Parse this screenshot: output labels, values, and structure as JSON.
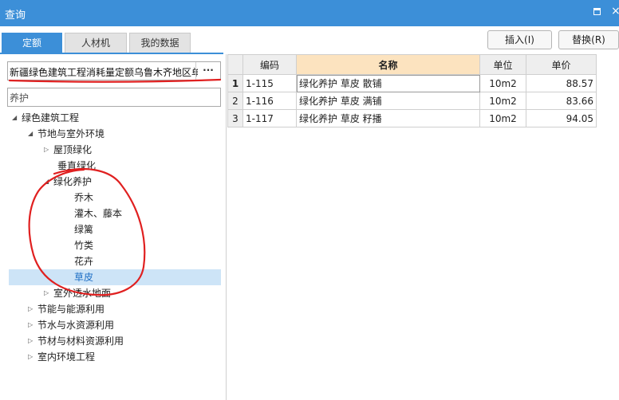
{
  "window": {
    "title": "查询",
    "restore_icon": "restore-icon",
    "close_glyph": "×"
  },
  "tabs": [
    {
      "label": "定额",
      "active": true
    },
    {
      "label": "人材机",
      "active": false
    },
    {
      "label": "我的数据",
      "active": false
    }
  ],
  "toolbar": {
    "insert_label": "插入(I)",
    "replace_label": "替换(R)"
  },
  "library": {
    "selected": "新疆绿色建筑工程消耗量定额乌鲁木齐地区单",
    "more_label": "···"
  },
  "search": {
    "value": "养护"
  },
  "tree": [
    {
      "label": "绿色建筑工程",
      "arrow": "◢"
    },
    {
      "label": "节地与室外环境",
      "arrow": "◢"
    },
    {
      "label": "屋顶绿化",
      "arrow": "▷"
    },
    {
      "label": "垂直绿化",
      "arrow": ""
    },
    {
      "label": "绿化养护",
      "arrow": "◢"
    },
    {
      "label": "乔木",
      "arrow": ""
    },
    {
      "label": "灌木、藤本",
      "arrow": ""
    },
    {
      "label": "绿篱",
      "arrow": ""
    },
    {
      "label": "竹类",
      "arrow": ""
    },
    {
      "label": "花卉",
      "arrow": ""
    },
    {
      "label": "草皮",
      "arrow": "",
      "selected": true
    },
    {
      "label": "室外透水地面",
      "arrow": "▷"
    },
    {
      "label": "节能与能源利用",
      "arrow": "▷"
    },
    {
      "label": "节水与水资源利用",
      "arrow": "▷"
    },
    {
      "label": "节材与材料资源利用",
      "arrow": "▷"
    },
    {
      "label": "室内环境工程",
      "arrow": "▷"
    }
  ],
  "table": {
    "headers": {
      "code": "编码",
      "name": "名称",
      "unit": "单位",
      "price": "单价"
    },
    "rows": [
      {
        "num": "1",
        "code": "1-115",
        "name": "绿化养护 草皮 散铺",
        "unit": "10m2",
        "price": "88.57"
      },
      {
        "num": "2",
        "code": "1-116",
        "name": "绿化养护 草皮 满铺",
        "unit": "10m2",
        "price": "83.66"
      },
      {
        "num": "3",
        "code": "1-117",
        "name": "绿化养护 草皮 籽播",
        "unit": "10m2",
        "price": "94.05"
      }
    ]
  },
  "annotation_color": "#e02020"
}
